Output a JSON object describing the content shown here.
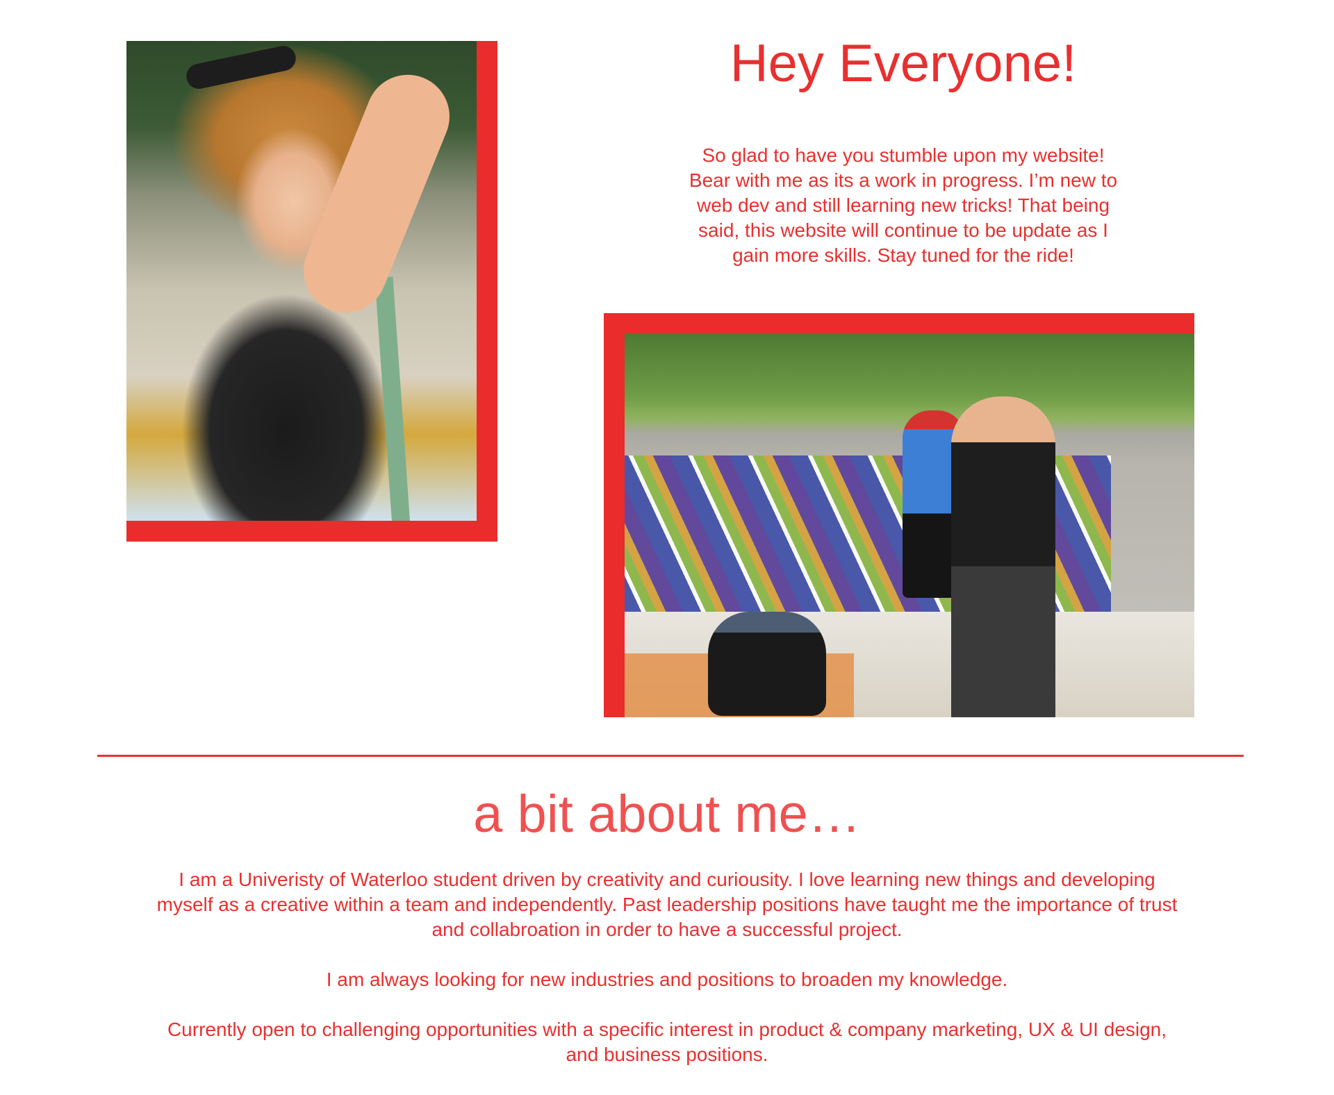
{
  "hero": {
    "title": "Hey Everyone!",
    "intro_lines": [
      "So glad to have you stumble upon my website!",
      "Bear with me as its a work in progress. I’m new to",
      "web dev and still learning new tricks! That being",
      "said, this website will continue to be update as I",
      "gain more skills. Stay tuned for the ride!"
    ]
  },
  "photos": {
    "portrait": "portrait-photo",
    "skatepark": "skatepark-photo"
  },
  "about": {
    "title": "a bit about me…",
    "paragraphs": [
      {
        "lines": [
          "I am a Univeristy of Waterloo student driven by creativity and curiousity. I love learning new things and developing",
          "myself as a creative within a team and independently. Past leadership positions have taught me the importance of trust",
          "and collabroation in order to have a successful project."
        ]
      },
      {
        "lines": [
          "I am always looking for new industries and positions to broaden my knowledge."
        ]
      },
      {
        "lines": [
          "Currently open to challenging opportunities with a specific interest in product & company marketing, UX & UI design,",
          "and business positions."
        ]
      }
    ]
  },
  "colors": {
    "accent": "#e8302f",
    "frame": "#ea2c2c",
    "about_title": "#ef5151",
    "background": "#ffffff"
  }
}
